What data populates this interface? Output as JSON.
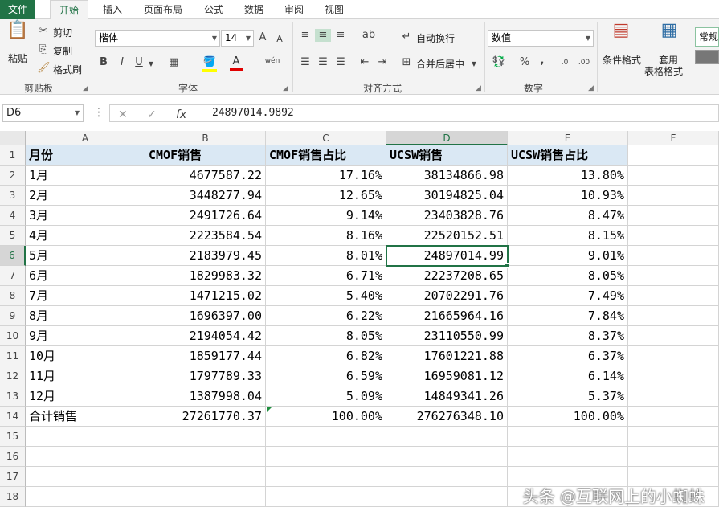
{
  "tabs": [
    "文件",
    "开始",
    "插入",
    "页面布局",
    "公式",
    "数据",
    "审阅",
    "视图"
  ],
  "ribbon": {
    "clipboard": {
      "paste": "粘贴",
      "cut": "剪切",
      "copy": "复制",
      "format_painter": "格式刷",
      "label": "剪贴板"
    },
    "font": {
      "name": "楷体",
      "size": "14",
      "label": "字体",
      "bold": "B",
      "italic": "I",
      "underline": "U",
      "font_color": "A",
      "phonetic": "wén",
      "grow": "A",
      "shrink": "A"
    },
    "alignment": {
      "wrap": "自动换行",
      "merge": "合并后居中",
      "label": "对齐方式"
    },
    "number": {
      "format": "数值",
      "percent": "%",
      "comma": ",",
      "label": "数字"
    },
    "styles": {
      "conditional": "条件格式",
      "table_format_1": "套用",
      "table_format_2": "表格格式",
      "cell_style": "常规"
    }
  },
  "formula_bar": {
    "name_box": "D6",
    "fx": "fx",
    "value": "24897014.9892"
  },
  "columns": [
    "A",
    "B",
    "C",
    "D",
    "E",
    "F"
  ],
  "rows": [
    [
      "月份",
      "CMOF销售",
      "CMOF销售占比",
      "UCSW销售",
      "UCSW销售占比"
    ],
    [
      "1月",
      "4677587.22",
      "17.16%",
      "38134866.98",
      "13.80%"
    ],
    [
      "2月",
      "3448277.94",
      "12.65%",
      "30194825.04",
      "10.93%"
    ],
    [
      "3月",
      "2491726.64",
      "9.14%",
      "23403828.76",
      "8.47%"
    ],
    [
      "4月",
      "2223584.54",
      "8.16%",
      "22520152.51",
      "8.15%"
    ],
    [
      "5月",
      "2183979.45",
      "8.01%",
      "24897014.99",
      "9.01%"
    ],
    [
      "6月",
      "1829983.32",
      "6.71%",
      "22237208.65",
      "8.05%"
    ],
    [
      "7月",
      "1471215.02",
      "5.40%",
      "20702291.76",
      "7.49%"
    ],
    [
      "8月",
      "1696397.00",
      "6.22%",
      "21665964.16",
      "7.84%"
    ],
    [
      "9月",
      "2194054.42",
      "8.05%",
      "23110550.99",
      "8.37%"
    ],
    [
      "10月",
      "1859177.44",
      "6.82%",
      "17601221.88",
      "6.37%"
    ],
    [
      "11月",
      "1797789.33",
      "6.59%",
      "16959081.12",
      "6.14%"
    ],
    [
      "12月",
      "1387998.04",
      "5.09%",
      "14849341.26",
      "5.37%"
    ],
    [
      "合计销售",
      "27261770.37",
      "100.00%",
      "276276348.10",
      "100.00%"
    ]
  ],
  "total_rows": 18,
  "selected_cell": "D6",
  "watermark": "头条 @互联网上的小蜘蛛",
  "colors": {
    "accent": "#217346",
    "header_fill": "#dae8f4"
  }
}
